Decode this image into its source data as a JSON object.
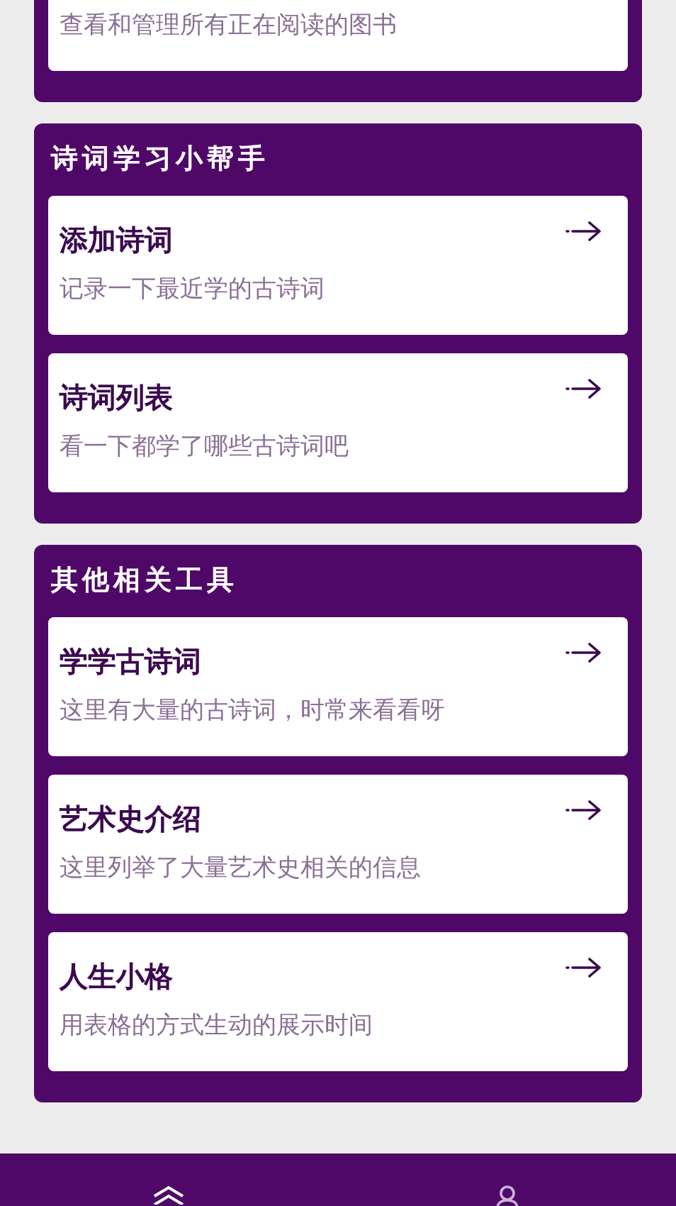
{
  "top_card": {
    "subtitle": "查看和管理所有正在阅读的图书"
  },
  "sections": [
    {
      "title": "诗词学习小帮手",
      "items": [
        {
          "title": "添加诗词",
          "subtitle": "记录一下最近学的古诗词"
        },
        {
          "title": "诗词列表",
          "subtitle": "看一下都学了哪些古诗词吧"
        }
      ]
    },
    {
      "title": "其他相关工具",
      "items": [
        {
          "title": "学学古诗词",
          "subtitle": "这里有大量的古诗词，时常来看看呀"
        },
        {
          "title": "艺术史介绍",
          "subtitle": "这里列举了大量艺术史相关的信息"
        },
        {
          "title": "人生小格",
          "subtitle": "用表格的方式生动的展示时间"
        }
      ]
    }
  ],
  "bottom_nav": [
    {
      "kind": "home",
      "selected": true
    },
    {
      "kind": "profile",
      "selected": false
    }
  ]
}
